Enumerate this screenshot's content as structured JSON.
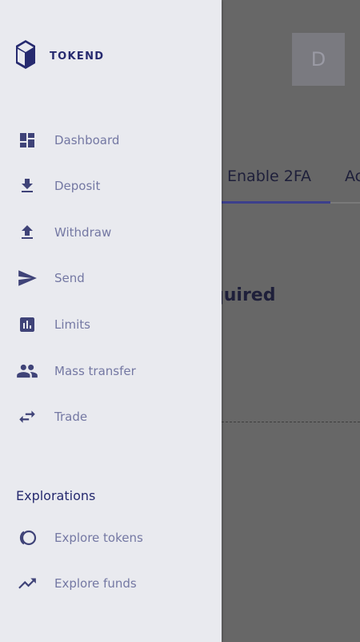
{
  "background": {
    "avatar_letter": "D",
    "tabs": [
      {
        "label": "Enable 2FA"
      },
      {
        "label": "Ac"
      }
    ],
    "heading": "quired"
  },
  "drawer": {
    "logo_text": "TOKEND",
    "nav_items": [
      {
        "label": "Dashboard",
        "icon": "dashboard-icon"
      },
      {
        "label": "Deposit",
        "icon": "download-icon"
      },
      {
        "label": "Withdraw",
        "icon": "upload-icon"
      },
      {
        "label": "Send",
        "icon": "send-icon"
      },
      {
        "label": "Limits",
        "icon": "bar-chart-icon"
      },
      {
        "label": "Mass transfer",
        "icon": "people-icon"
      },
      {
        "label": "Trade",
        "icon": "swap-arrows-icon"
      }
    ],
    "explorations": {
      "title": "Explorations",
      "items": [
        {
          "label": "Explore tokens",
          "icon": "tokens-icon"
        },
        {
          "label": "Explore funds",
          "icon": "trending-up-icon"
        }
      ]
    }
  },
  "colors": {
    "icon": "#3f4378",
    "label": "#7478a3",
    "brand": "#262a6f",
    "drawer_bg": "#e9eaef",
    "overlay": "#676767"
  }
}
